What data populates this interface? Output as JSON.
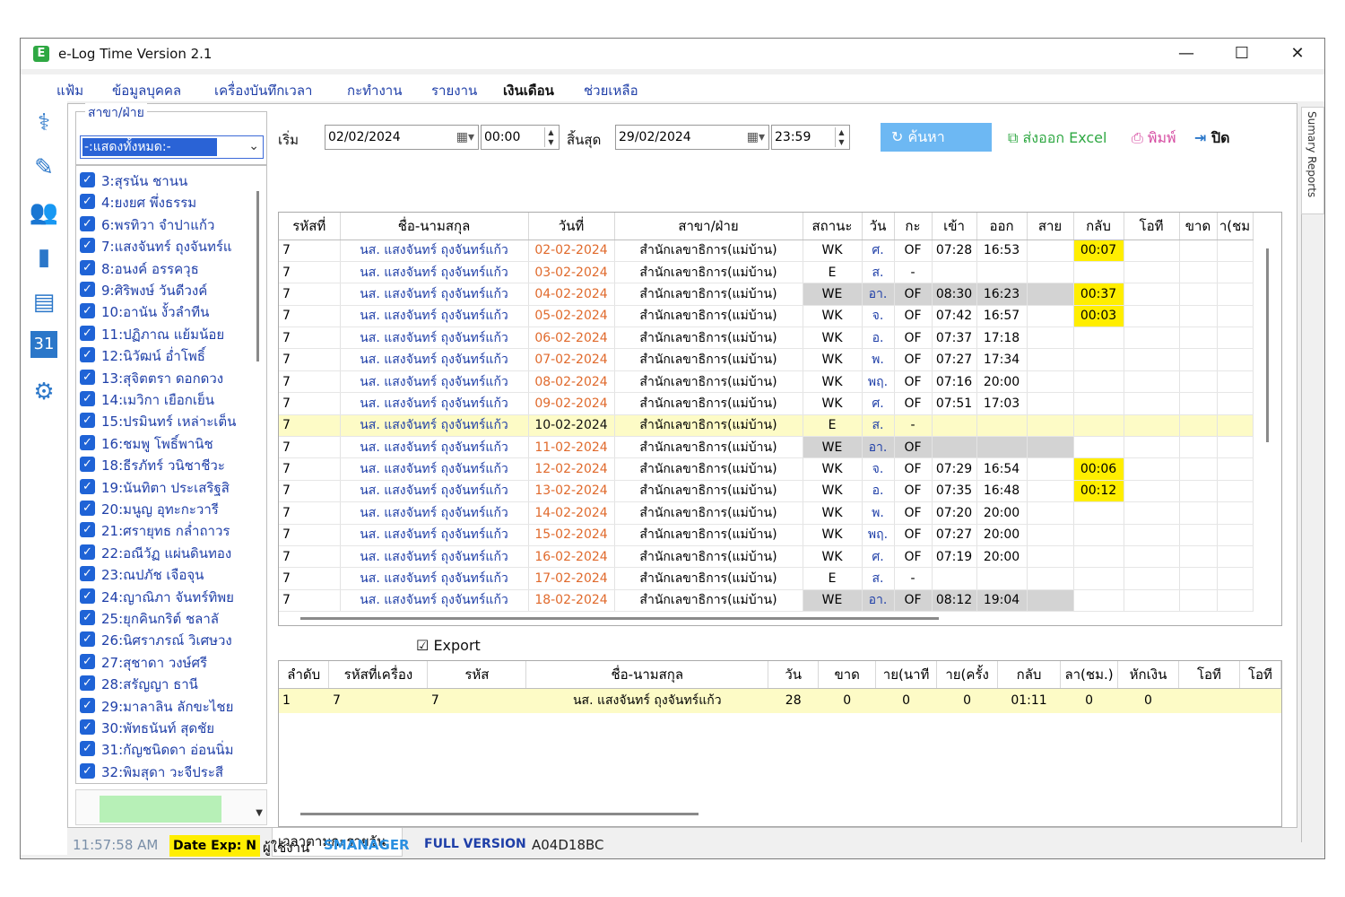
{
  "window": {
    "title": "e-Log Time Version 2.1",
    "app_icon": "E",
    "controls": {
      "minimize": "—",
      "maximize": "☐",
      "close": "✕"
    }
  },
  "menu": [
    "แฟ้ม",
    "ข้อมูลบุคคล",
    "เครื่องบันทึกเวลา",
    "กะทำงาน",
    "รายงาน",
    "เงินเดือน",
    "ช่วยเหลือ"
  ],
  "left_icons": [
    "stethoscope-icon",
    "bandage-icon",
    "people-icon",
    "chart-icon",
    "document-icon",
    "calendar-icon",
    "settings-icon"
  ],
  "calendar_day": "31",
  "branch": {
    "legend": "สาขา/ฝ่าย",
    "selected": "-:แสดงทั้งหมด:-"
  },
  "employees": [
    "3:สุรนัน ชานน",
    "4:ยงยศ พึ่งธรรม",
    "6:พรทิวา จำปาแก้ว",
    "7:แสงจันทร์ ถุงจันทร์แ",
    "8:อนงค์ อรรควุธ",
    "9:ศิริพงษ์ วันดีวงค์",
    "10:อานัน งั้วลำทีน",
    "11:ปฏิภาณ แย้มน้อย",
    "12:นิวัฒน์ อ่ำโพธิ์",
    "13:สุจิตตรา ดอกดวง",
    "14:เมวิกา เยือกเย็น",
    "15:ปรมินทร์ เหล่าะเต็น",
    "16:ชมพู โพธิ์พานิช",
    "18:ธีรภัทร์ วนิชาชีวะ",
    "19:นันทิตา ประเสริฐสิ",
    "20:มนูญ อุทะกะวารี",
    "21:ศรายุทธ กล่ำถาวร",
    "22:อณีวัฏ แผ่นดินทอง",
    "23:ณปภัช เจือจุน",
    "24:ญาณิภา จันทร์ทิพย",
    "25:ยุกคินกริต์ ชลาลั",
    "26:นิศราภรณ์ วิเศษวง",
    "27:สุชาดา วงษ์ศรี",
    "28:สรัญญา ธานี",
    "29:มาลาลิน ลักขะไชย",
    "30:พัทธนันท์ สุดชัย",
    "31:กัญชนิดดา อ่อนนิ่ม",
    "32:พิมสุดา วะจีประสี"
  ],
  "toolbar": {
    "start_label": "เริ่ม",
    "start_date": "02/02/2024",
    "start_time": "00:00",
    "end_label": "สิ้นสุด",
    "end_date": "29/02/2024",
    "end_time": "23:59",
    "search": "ค้นหา",
    "excel": "ส่งออก Excel",
    "print": "พิมพ์",
    "close": "ปิด"
  },
  "grid1": {
    "columns": [
      "รหัสที่",
      "ชื่อ-นามสกุล",
      "วันที่",
      "สาขา/ฝ่าย",
      "สถานะ",
      "วัน",
      "กะ",
      "เข้า",
      "ออก",
      "สาย",
      "กลับ",
      "โอที",
      "ขาด",
      "า(ชม"
    ],
    "rows": [
      {
        "id": "7",
        "name": "นส. แสงจันทร์ ถุงจันทร์แก้ว",
        "date": "02-02-2024",
        "branch": "สำนักเลขาธิการ(แม่บ้าน)",
        "status": "WK",
        "day": "ศ.",
        "shift": "OF",
        "in": "07:28",
        "out": "16:53",
        "late": "",
        "early": "00:07",
        "ot": "",
        "absent": "",
        "leave": ""
      },
      {
        "id": "7",
        "name": "นส. แสงจันทร์ ถุงจันทร์แก้ว",
        "date": "03-02-2024",
        "branch": "สำนักเลขาธิการ(แม่บ้าน)",
        "status": "E",
        "day": "ส.",
        "shift": "-",
        "in": "",
        "out": "",
        "late": "",
        "early": "",
        "ot": "",
        "absent": "",
        "leave": ""
      },
      {
        "id": "7",
        "name": "นส. แสงจันทร์ ถุงจันทร์แก้ว",
        "date": "04-02-2024",
        "branch": "สำนักเลขาธิการ(แม่บ้าน)",
        "status": "WE",
        "day": "อา.",
        "shift": "OF",
        "in": "08:30",
        "out": "16:23",
        "late": "",
        "early": "00:37",
        "ot": "",
        "absent": "",
        "leave": ""
      },
      {
        "id": "7",
        "name": "นส. แสงจันทร์ ถุงจันทร์แก้ว",
        "date": "05-02-2024",
        "branch": "สำนักเลขาธิการ(แม่บ้าน)",
        "status": "WK",
        "day": "จ.",
        "shift": "OF",
        "in": "07:42",
        "out": "16:57",
        "late": "",
        "early": "00:03",
        "ot": "",
        "absent": "",
        "leave": ""
      },
      {
        "id": "7",
        "name": "นส. แสงจันทร์ ถุงจันทร์แก้ว",
        "date": "06-02-2024",
        "branch": "สำนักเลขาธิการ(แม่บ้าน)",
        "status": "WK",
        "day": "อ.",
        "shift": "OF",
        "in": "07:37",
        "out": "17:18",
        "late": "",
        "early": "",
        "ot": "",
        "absent": "",
        "leave": ""
      },
      {
        "id": "7",
        "name": "นส. แสงจันทร์ ถุงจันทร์แก้ว",
        "date": "07-02-2024",
        "branch": "สำนักเลขาธิการ(แม่บ้าน)",
        "status": "WK",
        "day": "พ.",
        "shift": "OF",
        "in": "07:27",
        "out": "17:34",
        "late": "",
        "early": "",
        "ot": "",
        "absent": "",
        "leave": ""
      },
      {
        "id": "7",
        "name": "นส. แสงจันทร์ ถุงจันทร์แก้ว",
        "date": "08-02-2024",
        "branch": "สำนักเลขาธิการ(แม่บ้าน)",
        "status": "WK",
        "day": "พฤ.",
        "shift": "OF",
        "in": "07:16",
        "out": "20:00",
        "late": "",
        "early": "",
        "ot": "",
        "absent": "",
        "leave": ""
      },
      {
        "id": "7",
        "name": "นส. แสงจันทร์ ถุงจันทร์แก้ว",
        "date": "09-02-2024",
        "branch": "สำนักเลขาธิการ(แม่บ้าน)",
        "status": "WK",
        "day": "ศ.",
        "shift": "OF",
        "in": "07:51",
        "out": "17:03",
        "late": "",
        "early": "",
        "ot": "",
        "absent": "",
        "leave": ""
      },
      {
        "id": "7",
        "name": "นส. แสงจันทร์ ถุงจันทร์แก้ว",
        "date": "10-02-2024",
        "branch": "สำนักเลขาธิการ(แม่บ้าน)",
        "status": "E",
        "day": "ส.",
        "shift": "-",
        "in": "",
        "out": "",
        "late": "",
        "early": "",
        "ot": "",
        "absent": "",
        "leave": ""
      },
      {
        "id": "7",
        "name": "นส. แสงจันทร์ ถุงจันทร์แก้ว",
        "date": "11-02-2024",
        "branch": "สำนักเลขาธิการ(แม่บ้าน)",
        "status": "WE",
        "day": "อา.",
        "shift": "OF",
        "in": "",
        "out": "",
        "late": "",
        "early": "",
        "ot": "",
        "absent": "",
        "leave": ""
      },
      {
        "id": "7",
        "name": "นส. แสงจันทร์ ถุงจันทร์แก้ว",
        "date": "12-02-2024",
        "branch": "สำนักเลขาธิการ(แม่บ้าน)",
        "status": "WK",
        "day": "จ.",
        "shift": "OF",
        "in": "07:29",
        "out": "16:54",
        "late": "",
        "early": "00:06",
        "ot": "",
        "absent": "",
        "leave": ""
      },
      {
        "id": "7",
        "name": "นส. แสงจันทร์ ถุงจันทร์แก้ว",
        "date": "13-02-2024",
        "branch": "สำนักเลขาธิการ(แม่บ้าน)",
        "status": "WK",
        "day": "อ.",
        "shift": "OF",
        "in": "07:35",
        "out": "16:48",
        "late": "",
        "early": "00:12",
        "ot": "",
        "absent": "",
        "leave": ""
      },
      {
        "id": "7",
        "name": "นส. แสงจันทร์ ถุงจันทร์แก้ว",
        "date": "14-02-2024",
        "branch": "สำนักเลขาธิการ(แม่บ้าน)",
        "status": "WK",
        "day": "พ.",
        "shift": "OF",
        "in": "07:20",
        "out": "20:00",
        "late": "",
        "early": "",
        "ot": "",
        "absent": "",
        "leave": ""
      },
      {
        "id": "7",
        "name": "นส. แสงจันทร์ ถุงจันทร์แก้ว",
        "date": "15-02-2024",
        "branch": "สำนักเลขาธิการ(แม่บ้าน)",
        "status": "WK",
        "day": "พฤ.",
        "shift": "OF",
        "in": "07:27",
        "out": "20:00",
        "late": "",
        "early": "",
        "ot": "",
        "absent": "",
        "leave": ""
      },
      {
        "id": "7",
        "name": "นส. แสงจันทร์ ถุงจันทร์แก้ว",
        "date": "16-02-2024",
        "branch": "สำนักเลขาธิการ(แม่บ้าน)",
        "status": "WK",
        "day": "ศ.",
        "shift": "OF",
        "in": "07:19",
        "out": "20:00",
        "late": "",
        "early": "",
        "ot": "",
        "absent": "",
        "leave": ""
      },
      {
        "id": "7",
        "name": "นส. แสงจันทร์ ถุงจันทร์แก้ว",
        "date": "17-02-2024",
        "branch": "สำนักเลขาธิการ(แม่บ้าน)",
        "status": "E",
        "day": "ส.",
        "shift": "-",
        "in": "",
        "out": "",
        "late": "",
        "early": "",
        "ot": "",
        "absent": "",
        "leave": ""
      },
      {
        "id": "7",
        "name": "นส. แสงจันทร์ ถุงจันทร์แก้ว",
        "date": "18-02-2024",
        "branch": "สำนักเลขาธิการ(แม่บ้าน)",
        "status": "WE",
        "day": "อา.",
        "shift": "OF",
        "in": "08:12",
        "out": "19:04",
        "late": "",
        "early": "",
        "ot": "",
        "absent": "",
        "leave": ""
      }
    ]
  },
  "export_label": "Export",
  "grid2": {
    "columns": [
      "ลำดับ",
      "รหัสที่เครื่อง",
      "รหัส",
      "ชื่อ-นามสกุล",
      "วัน",
      "ขาด",
      "าย(นาที",
      "าย(ครั้ง",
      "กลับ",
      "ลา(ชม.)",
      "หักเงิน",
      "โอที",
      "โอที"
    ],
    "row": [
      "1",
      "7",
      "7",
      "นส. แสงจันทร์ ถุงจันทร์แก้ว",
      "28",
      "0",
      "0",
      "0",
      "01:11",
      "0",
      "0",
      "",
      ""
    ]
  },
  "bottom_tab": "เวลาตามกะรายวัน",
  "right_tab": "Sumary Reports",
  "status": {
    "time": "11:57:58 AM",
    "date_exp": "Date Exp: N",
    "user_label": "ผู้ใช้งาน",
    "user": "SMANAGER",
    "version": "FULL VERSION",
    "code": "A04D18BC"
  },
  "colors": {
    "accent_blue": "#1f3fa8",
    "highlight_yellow": "#ffee00",
    "row_highlight": "#fdfbc6",
    "weekend_gray": "#d3d3d3",
    "search_blue": "#6db8f3"
  }
}
